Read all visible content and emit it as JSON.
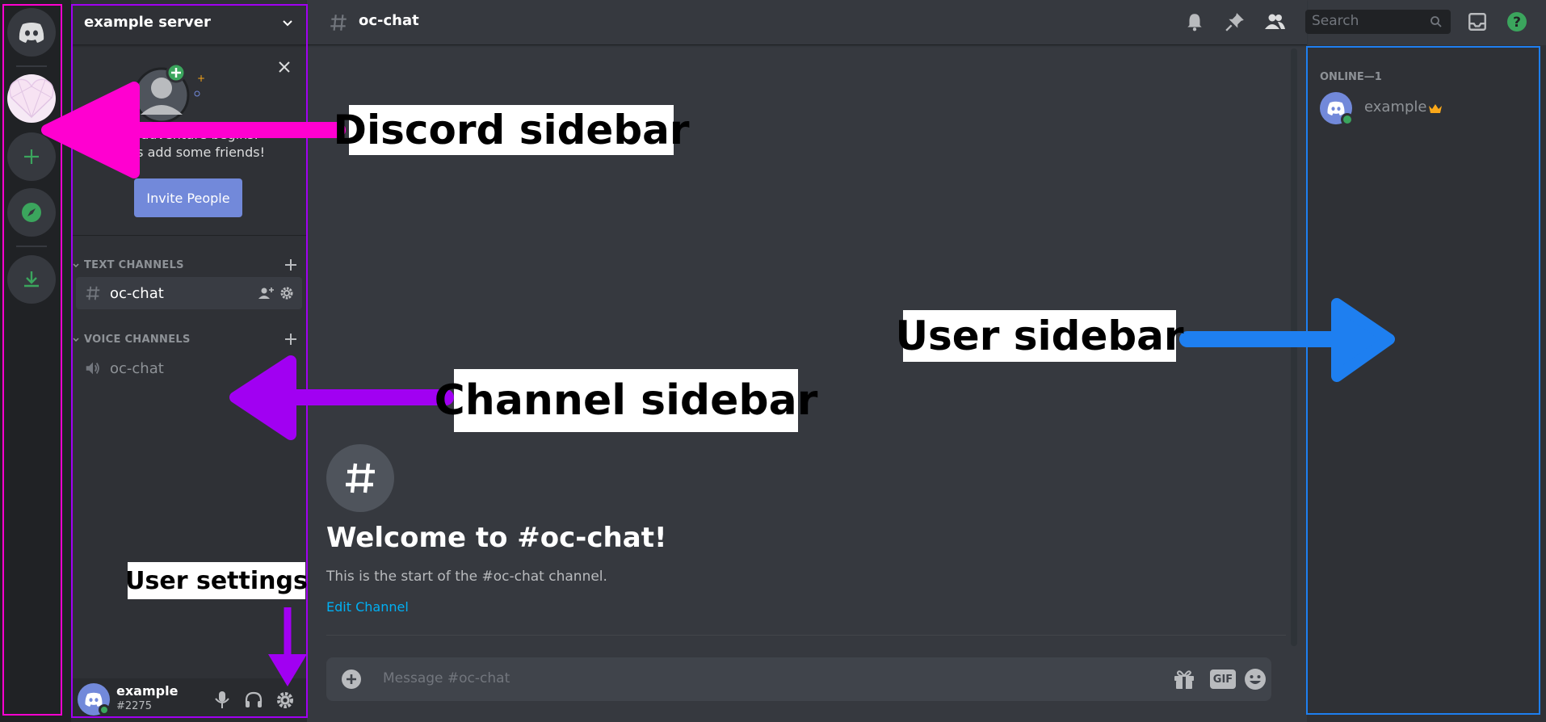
{
  "server": {
    "name": "example server"
  },
  "invite": {
    "text_line1": "An adventure begins.",
    "text_line2": "Let's add some friends!",
    "button_label": "Invite People"
  },
  "categories": {
    "text": "TEXT CHANNELS",
    "voice": "VOICE CHANNELS"
  },
  "channels": {
    "text": [
      {
        "name": "oc-chat"
      }
    ],
    "voice": [
      {
        "name": "oc-chat"
      }
    ]
  },
  "user": {
    "name": "example",
    "tag": "#2275"
  },
  "header": {
    "channel_name": "oc-chat",
    "search_placeholder": "Search"
  },
  "welcome": {
    "title": "Welcome to #oc-chat!",
    "subtitle": "This is the start of the #oc-chat channel.",
    "edit_link": "Edit Channel"
  },
  "composer": {
    "placeholder": "Message #oc-chat",
    "gif_label": "GIF"
  },
  "members": {
    "group_label": "ONLINE—1",
    "items": [
      {
        "name": "example",
        "status": "online",
        "owner": true
      }
    ]
  },
  "annotations": {
    "discord_sidebar": "Discord sidebar",
    "channel_sidebar": "Channel sidebar",
    "user_sidebar": "User sidebar",
    "user_settings": "User settings"
  },
  "colors": {
    "blurple": "#7289da",
    "green": "#3ba55d",
    "link": "#00b0f4",
    "annotation_magenta": "#ff00d0",
    "annotation_purple": "#a100f2",
    "annotation_blue": "#1e7ff0",
    "owner_crown": "#faa81a"
  }
}
